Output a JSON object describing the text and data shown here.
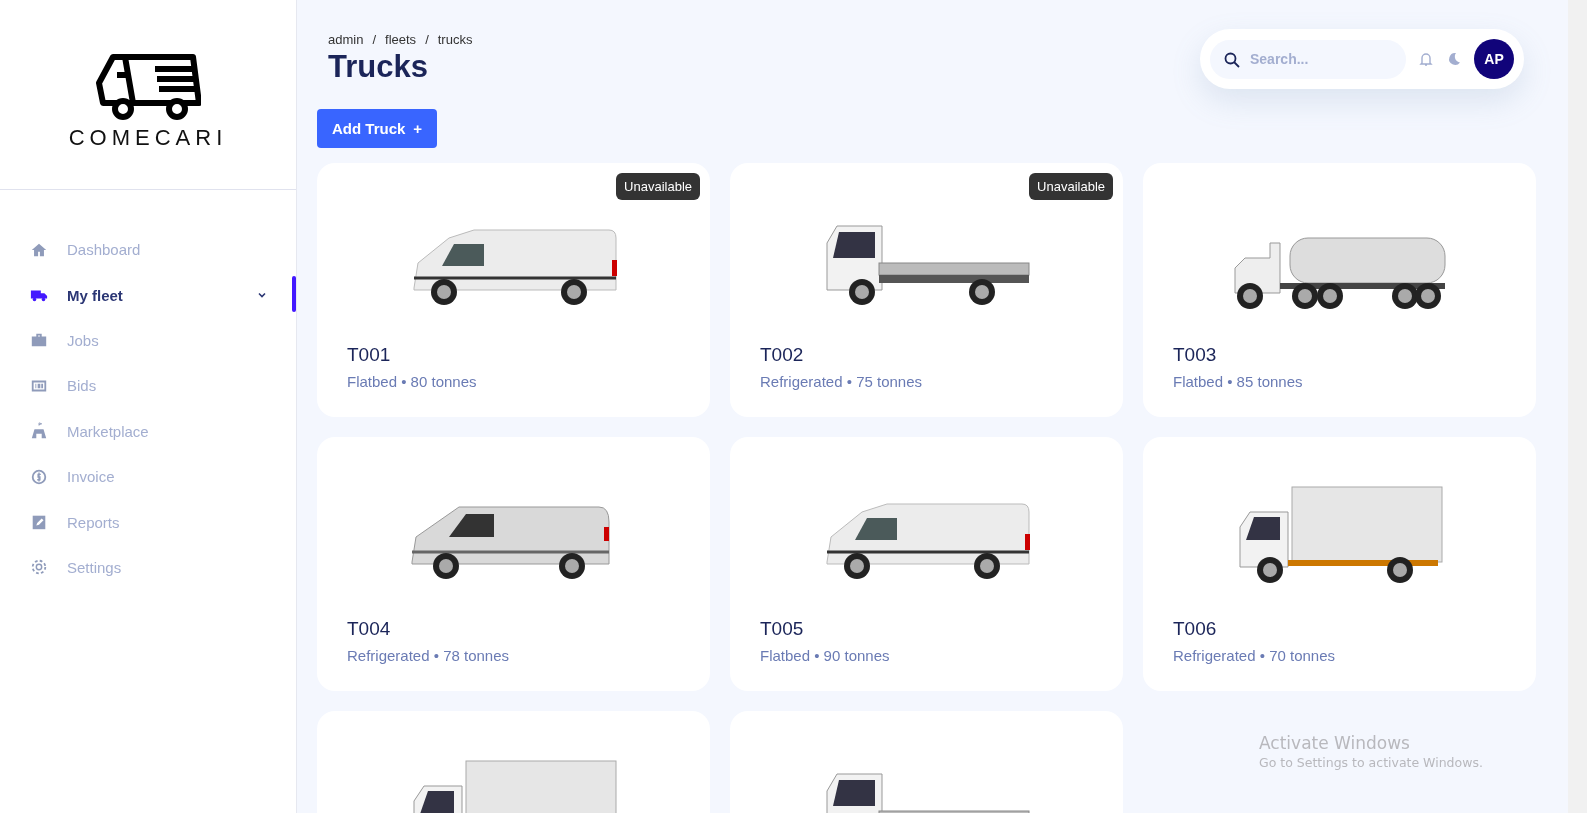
{
  "brand": {
    "name": "COMECARI"
  },
  "sidebar": {
    "items": [
      {
        "label": "Dashboard",
        "selected": false,
        "kind": "link"
      },
      {
        "label": "My fleet",
        "selected": true,
        "kind": "group"
      },
      {
        "label": "Jobs",
        "selected": false,
        "kind": "link"
      },
      {
        "label": "Bids",
        "selected": false,
        "kind": "link"
      },
      {
        "label": "Marketplace",
        "selected": false,
        "kind": "link"
      },
      {
        "label": "Invoice",
        "selected": false,
        "kind": "link"
      },
      {
        "label": "Reports",
        "selected": false,
        "kind": "link"
      },
      {
        "label": "Settings",
        "selected": false,
        "kind": "link"
      }
    ]
  },
  "breadcrumb": [
    "admin",
    "fleets",
    "trucks"
  ],
  "breadcrumb_separator": "/",
  "title": "Trucks",
  "search": {
    "placeholder": "Search..."
  },
  "avatar": {
    "initials": "AP"
  },
  "add_button": {
    "label": "Add Truck",
    "icon": "+"
  },
  "trucks": [
    {
      "kind": "van",
      "id": "T001",
      "details": "Flatbed • 80 tonnes",
      "badge": "Unavailable"
    },
    {
      "kind": "flatbed",
      "id": "T002",
      "details": "Refrigerated • 75 tonnes",
      "badge": "Unavailable"
    },
    {
      "kind": "tanker",
      "id": "T003",
      "details": "Flatbed • 85 tonnes"
    },
    {
      "kind": "minivan",
      "id": "T004",
      "details": "Refrigerated • 78 tonnes"
    },
    {
      "kind": "van",
      "id": "T005",
      "details": "Flatbed • 90 tonnes"
    },
    {
      "kind": "box",
      "id": "T006",
      "details": "Refrigerated • 70 tonnes"
    },
    {
      "kind": "box"
    },
    {
      "kind": "flatbed"
    }
  ],
  "os_notice": {
    "title": "Activate Windows",
    "text": "Go to Settings to activate Windows."
  }
}
